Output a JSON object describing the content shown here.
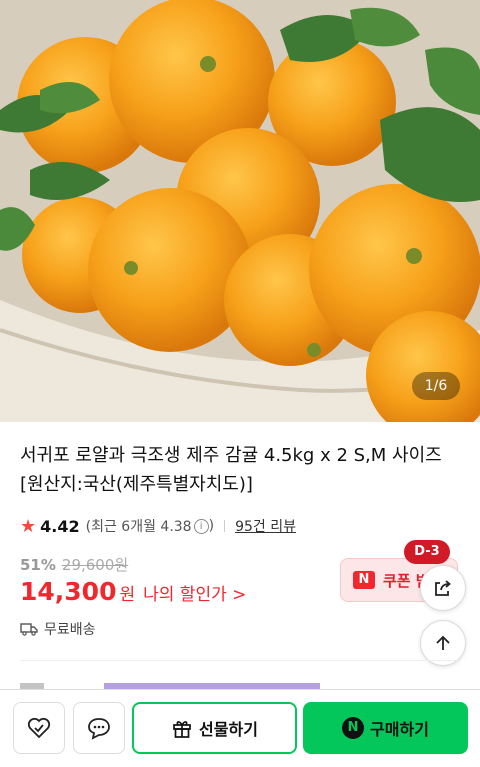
{
  "hero": {
    "image_counter": "1/6"
  },
  "product": {
    "title": "서귀포 로얄과 극조생 제주 감귤 4.5kg x 2 S,M 사이즈 [원산지:국산(제주특별자치도)]"
  },
  "rating": {
    "score": "4.42",
    "recent": "(최근 6개월 4.38",
    "recent_close": ")",
    "reviews": "95건 리뷰"
  },
  "price": {
    "discount_rate": "51%",
    "original": "29,600원",
    "sale": "14,300",
    "won": "원",
    "my_discount": "나의 할인가 >"
  },
  "coupon": {
    "icon": "N",
    "label": "쿠폰 받",
    "dday": "D-3"
  },
  "shipping": {
    "label": "무료배송"
  },
  "bottom": {
    "gift": "선물하기",
    "buy": "구매하기",
    "npay_icon": "N"
  },
  "colors": {
    "accent": "#03c75a",
    "sale": "#f2272e",
    "badge": "#d01a26"
  }
}
